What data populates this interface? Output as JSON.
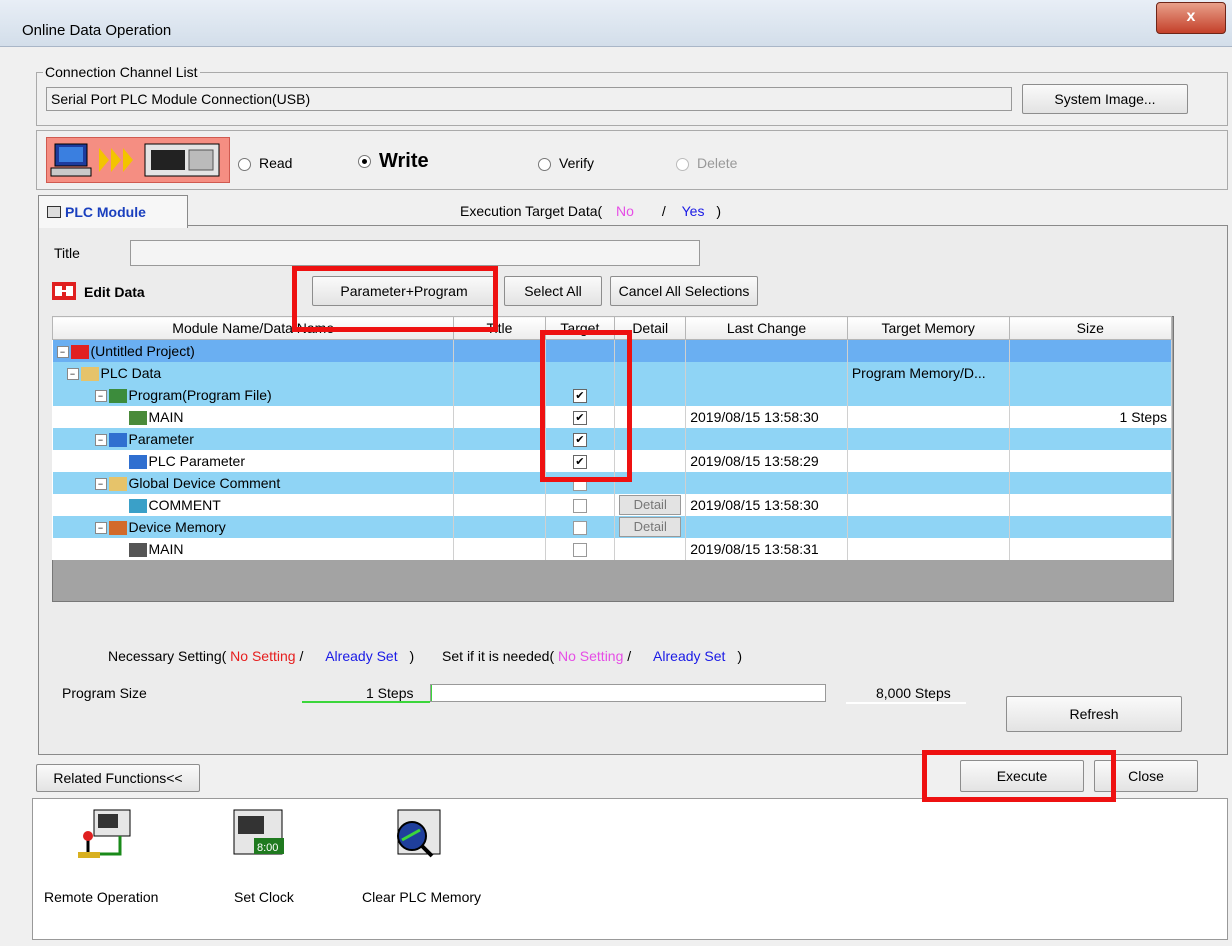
{
  "window": {
    "title": "Online Data Operation",
    "close_label": "x"
  },
  "connection": {
    "legend": "Connection Channel List",
    "value": "Serial Port  PLC Module Connection(USB)",
    "system_image_button": "System Image..."
  },
  "mode": {
    "read": "Read",
    "write": "Write",
    "verify": "Verify",
    "delete": "Delete"
  },
  "tab": {
    "label": "PLC Module"
  },
  "execution_target": {
    "prefix": "Execution Target Data(",
    "no": "No",
    "sep": "/",
    "yes": "Yes",
    "suffix": ")"
  },
  "title_field": {
    "label": "Title",
    "value": ""
  },
  "edit_data": {
    "label": "Edit Data",
    "param_program_button": "Parameter+Program",
    "select_all_button": "Select All",
    "cancel_all_button": "Cancel All Selections"
  },
  "table": {
    "headers": [
      "Module Name/Data Name",
      "Title",
      "Target",
      "Detail",
      "Last Change",
      "Target Memory",
      "Size"
    ],
    "rows": [
      {
        "name": "(Untitled Project)",
        "last_change": "",
        "target_memory": "",
        "size": "",
        "detail": ""
      },
      {
        "name": "PLC Data",
        "last_change": "",
        "target_memory": "Program Memory/D...",
        "size": "",
        "detail": ""
      },
      {
        "name": "Program(Program File)",
        "last_change": "",
        "target_memory": "",
        "size": "",
        "detail": ""
      },
      {
        "name": "MAIN",
        "last_change": "2019/08/15 13:58:30",
        "target_memory": "",
        "size": "1 Steps",
        "detail": ""
      },
      {
        "name": "Parameter",
        "last_change": "",
        "target_memory": "",
        "size": "",
        "detail": ""
      },
      {
        "name": "PLC Parameter",
        "last_change": "2019/08/15 13:58:29",
        "target_memory": "",
        "size": "",
        "detail": ""
      },
      {
        "name": "Global Device Comment",
        "last_change": "",
        "target_memory": "",
        "size": "",
        "detail": ""
      },
      {
        "name": "COMMENT",
        "last_change": "2019/08/15 13:58:30",
        "target_memory": "",
        "size": "",
        "detail": "Detail"
      },
      {
        "name": "Device Memory",
        "last_change": "",
        "target_memory": "",
        "size": "",
        "detail": "Detail"
      },
      {
        "name": "MAIN",
        "last_change": "2019/08/15 13:58:31",
        "target_memory": "",
        "size": "",
        "detail": ""
      }
    ]
  },
  "legend_row": {
    "necessary": "Necessary Setting(",
    "no_setting": "No Setting",
    "slash": "/",
    "already_set": "Already Set",
    "close": ")",
    "if_needed": "Set if it is needed(",
    "no_setting2": "No Setting",
    "slash2": "/",
    "already_set2": "Already Set",
    "close2": ")"
  },
  "program_size": {
    "label": "Program Size",
    "used": "1 Steps",
    "max": "8,000 Steps",
    "fraction": 0.000125
  },
  "buttons": {
    "refresh": "Refresh",
    "related": "Related Functions<<",
    "execute": "Execute",
    "close": "Close"
  },
  "functions": [
    {
      "label": "Remote Operation"
    },
    {
      "label": "Set Clock"
    },
    {
      "label": "Clear PLC Memory"
    }
  ],
  "colors": {
    "highlight_row": "#8fd4f5",
    "selected_row": "#6aaff2",
    "red_box": "#ee1111",
    "no_pink": "#e64ee6",
    "yes_blue": "#1a1ae6"
  }
}
